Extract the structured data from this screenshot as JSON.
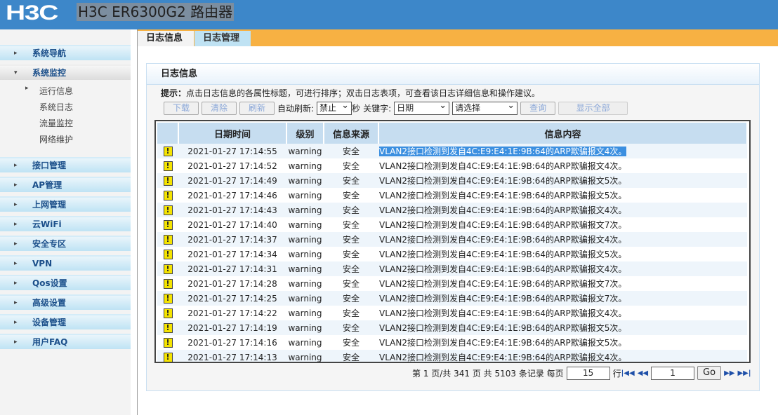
{
  "header": {
    "logo": "H3C",
    "title": "H3C ER6300G2 路由器"
  },
  "sidebar": {
    "items": [
      {
        "label": "系统导航"
      },
      {
        "label": "系统监控"
      },
      {
        "label": "接口管理"
      },
      {
        "label": "AP管理"
      },
      {
        "label": "上网管理"
      },
      {
        "label": "云WiFi"
      },
      {
        "label": "安全专区"
      },
      {
        "label": "VPN"
      },
      {
        "label": "Qos设置"
      },
      {
        "label": "高级设置"
      },
      {
        "label": "设备管理"
      },
      {
        "label": "用户FAQ"
      }
    ],
    "subitems": [
      {
        "label": "运行信息"
      },
      {
        "label": "系统日志"
      },
      {
        "label": "流量监控"
      },
      {
        "label": "网络维护"
      }
    ]
  },
  "tabs": [
    {
      "label": "日志信息"
    },
    {
      "label": "日志管理"
    }
  ],
  "panel": {
    "title": "日志信息",
    "tip_label": "提示：",
    "tip": "点击日志信息的各属性标题，可进行排序；双击日志表项，可查看该日志详细信息和操作建议。",
    "toolbar": {
      "download": "下载",
      "clear": "清除",
      "refresh": "刷新",
      "auto_refresh_label": "自动刷新:",
      "auto_refresh_value": "禁止",
      "seconds": "秒",
      "keyword_label": "关键字:",
      "keyword_value": "日期",
      "filter_value": "请选择",
      "query": "查询",
      "show_all": "显示全部"
    },
    "columns": [
      "日期时间",
      "级别",
      "信息来源",
      "信息内容"
    ],
    "rows": [
      {
        "time": "2021-01-27 17:14:55",
        "level": "warning",
        "source": "安全",
        "msg": "VLAN2接口检测到发自4C:E9:E4:1E:9B:64的ARP欺骗报文4次。"
      },
      {
        "time": "2021-01-27 17:14:52",
        "level": "warning",
        "source": "安全",
        "msg": "VLAN2接口检测到发自4C:E9:E4:1E:9B:64的ARP欺骗报文4次。"
      },
      {
        "time": "2021-01-27 17:14:49",
        "level": "warning",
        "source": "安全",
        "msg": "VLAN2接口检测到发自4C:E9:E4:1E:9B:64的ARP欺骗报文5次。"
      },
      {
        "time": "2021-01-27 17:14:46",
        "level": "warning",
        "source": "安全",
        "msg": "VLAN2接口检测到发自4C:E9:E4:1E:9B:64的ARP欺骗报文5次。"
      },
      {
        "time": "2021-01-27 17:14:43",
        "level": "warning",
        "source": "安全",
        "msg": "VLAN2接口检测到发自4C:E9:E4:1E:9B:64的ARP欺骗报文4次。"
      },
      {
        "time": "2021-01-27 17:14:40",
        "level": "warning",
        "source": "安全",
        "msg": "VLAN2接口检测到发自4C:E9:E4:1E:9B:64的ARP欺骗报文7次。"
      },
      {
        "time": "2021-01-27 17:14:37",
        "level": "warning",
        "source": "安全",
        "msg": "VLAN2接口检测到发自4C:E9:E4:1E:9B:64的ARP欺骗报文4次。"
      },
      {
        "time": "2021-01-27 17:14:34",
        "level": "warning",
        "source": "安全",
        "msg": "VLAN2接口检测到发自4C:E9:E4:1E:9B:64的ARP欺骗报文5次。"
      },
      {
        "time": "2021-01-27 17:14:31",
        "level": "warning",
        "source": "安全",
        "msg": "VLAN2接口检测到发自4C:E9:E4:1E:9B:64的ARP欺骗报文4次。"
      },
      {
        "time": "2021-01-27 17:14:28",
        "level": "warning",
        "source": "安全",
        "msg": "VLAN2接口检测到发自4C:E9:E4:1E:9B:64的ARP欺骗报文7次。"
      },
      {
        "time": "2021-01-27 17:14:25",
        "level": "warning",
        "source": "安全",
        "msg": "VLAN2接口检测到发自4C:E9:E4:1E:9B:64的ARP欺骗报文7次。"
      },
      {
        "time": "2021-01-27 17:14:22",
        "level": "warning",
        "source": "安全",
        "msg": "VLAN2接口检测到发自4C:E9:E4:1E:9B:64的ARP欺骗报文4次。"
      },
      {
        "time": "2021-01-27 17:14:19",
        "level": "warning",
        "source": "安全",
        "msg": "VLAN2接口检测到发自4C:E9:E4:1E:9B:64的ARP欺骗报文5次。"
      },
      {
        "time": "2021-01-27 17:14:16",
        "level": "warning",
        "source": "安全",
        "msg": "VLAN2接口检测到发自4C:E9:E4:1E:9B:64的ARP欺骗报文5次。"
      },
      {
        "time": "2021-01-27 17:14:13",
        "level": "warning",
        "source": "安全",
        "msg": "VLAN2接口检测到发自4C:E9:E4:1E:9B:64的ARP欺骗报文4次。"
      }
    ],
    "pager": {
      "summary": "第 1 页/共 341 页 共 5103 条记录 每页",
      "per_page": "15",
      "rows_label": "行",
      "page": "1",
      "go": "Go"
    }
  }
}
